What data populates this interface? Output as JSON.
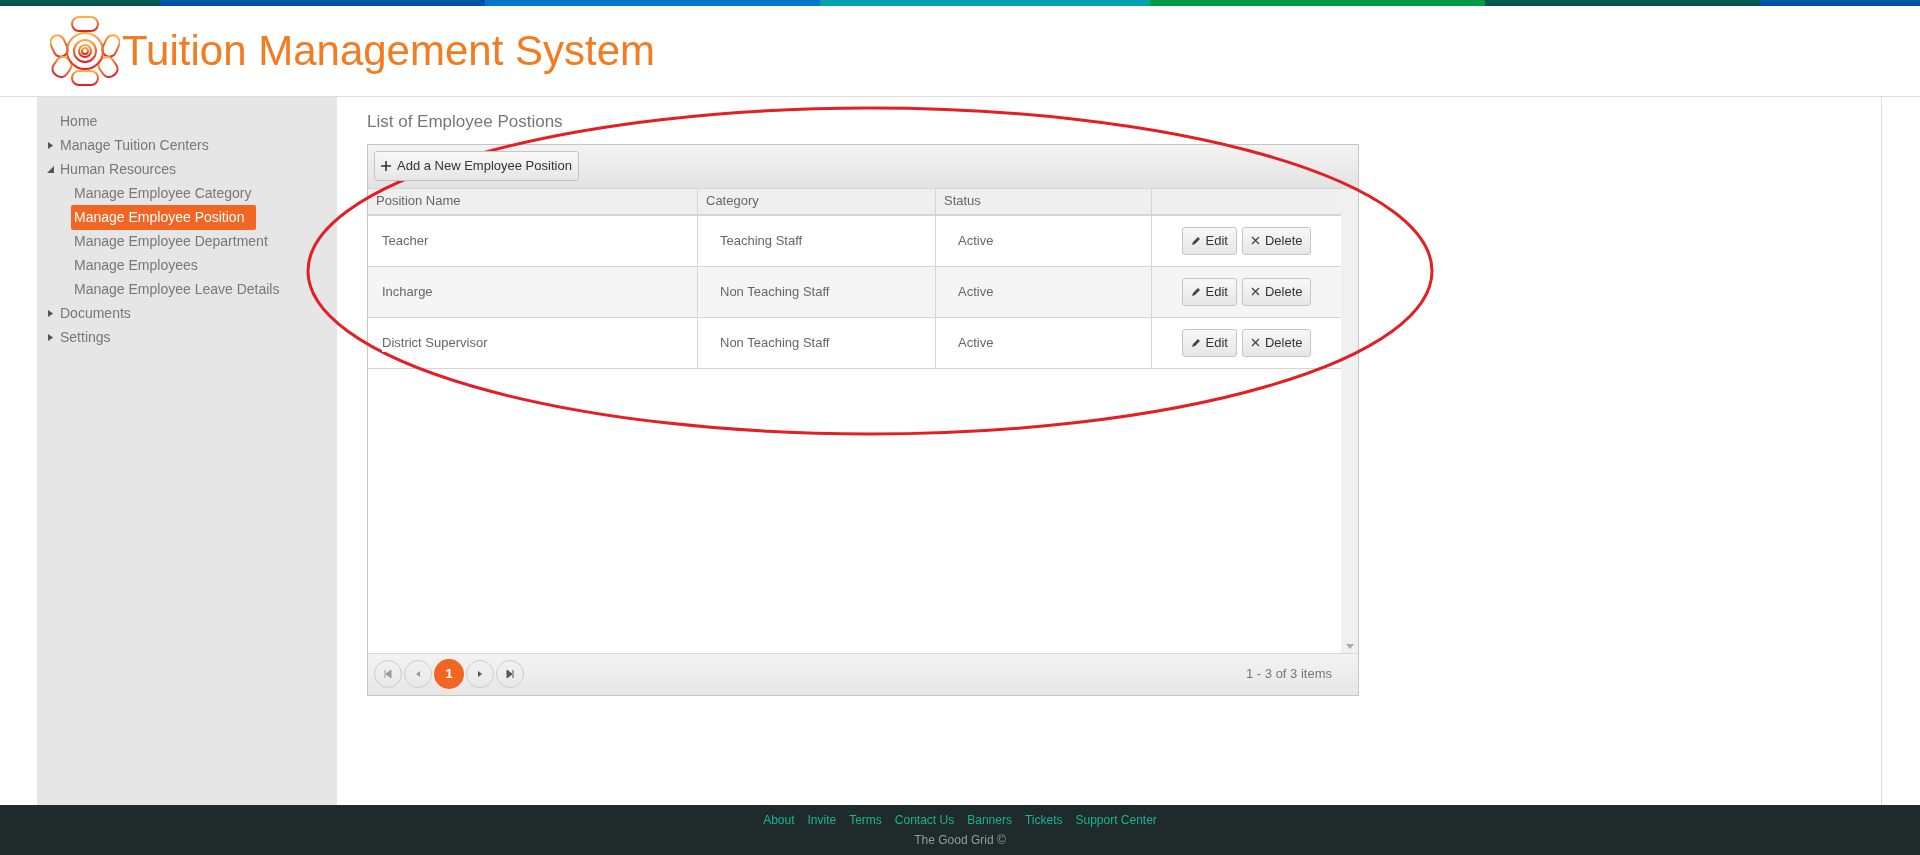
{
  "header": {
    "title": "Tuition Management System"
  },
  "sidebar": {
    "items": [
      {
        "label": "Home",
        "selected": false
      },
      {
        "label": "Manage Tuition Centers",
        "expanded": false,
        "selected": false
      },
      {
        "label": "Human Resources",
        "expanded": true,
        "selected": false,
        "children": [
          {
            "label": "Manage Employee Category",
            "selected": false
          },
          {
            "label": "Manage Employee Position",
            "selected": true
          },
          {
            "label": "Manage Employee Department",
            "selected": false
          },
          {
            "label": "Manage Employees",
            "selected": false
          },
          {
            "label": "Manage Employee Leave Details",
            "selected": false
          }
        ]
      },
      {
        "label": "Documents",
        "expanded": false,
        "selected": false
      },
      {
        "label": "Settings",
        "expanded": false,
        "selected": false
      }
    ]
  },
  "page_title": "List of Employee Postions",
  "grid": {
    "toolbar_button": "Add a New Employee Position",
    "columns": [
      "Position Name",
      "Category",
      "Status"
    ],
    "rows": [
      {
        "cells": [
          "Teacher",
          "Teaching Staff",
          "Active"
        ],
        "actions": [
          "Edit",
          "Delete"
        ]
      },
      {
        "cells": [
          "Incharge",
          "Non Teaching Staff",
          "Active"
        ],
        "actions": [
          "Edit",
          "Delete"
        ]
      },
      {
        "cells": [
          "District Supervisor",
          "Non Teaching Staff",
          "Active"
        ],
        "actions": [
          "Edit",
          "Delete"
        ]
      }
    ],
    "pager": {
      "pages": [
        {
          "label": "1",
          "selected": true
        }
      ],
      "summary": "1 - 3 of 3 items"
    }
  },
  "footer": {
    "links": [
      "About",
      "Invite",
      "Terms",
      "Contact Us",
      "Banners",
      "Tickets",
      "Support Center"
    ],
    "copyright": "The Good Grid ©"
  }
}
